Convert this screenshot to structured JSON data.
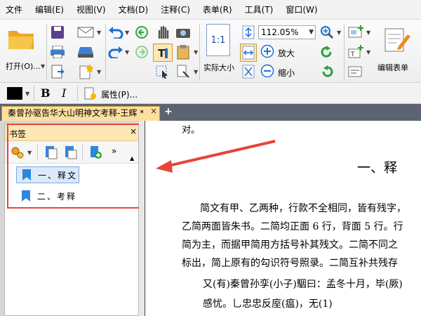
{
  "menu": [
    "文件",
    "编辑(E)",
    "视图(V)",
    "文档(D)",
    "注释(C)",
    "表单(R)",
    "工具(T)",
    "窗口(W)"
  ],
  "toolbar": {
    "open_label": "打开(O)...",
    "actual_size_label": "实际大小",
    "actual_size_glyph": "1:1",
    "zoom_value": "112.05%",
    "zoom_in_label": "放大",
    "zoom_out_label": "缩小",
    "edit_form_label": "编辑表单"
  },
  "format": {
    "bold_label": "B",
    "italic_label": "I",
    "properties_label": "属性(P)...",
    "color": "#000000"
  },
  "tab": {
    "title": "秦曾孙驱告华大山明神文考释-王辉 *",
    "close_glyph": "×",
    "add_glyph": "+"
  },
  "bookmarks": {
    "title": "书签",
    "close_glyph": "×",
    "items": [
      "一、释文",
      "二、考释"
    ]
  },
  "document": {
    "top_fragment": "对。",
    "heading": "一、释",
    "lines": [
      "简文有甲、乙两种，行款不全相同，皆有残字，",
      "乙简两面皆朱书。二简均正面 6 行，背面 5 行。行",
      "简为主，而据甲简用方括号补其残文。二简不同之",
      "标出，简上原有的勾识符号照录。二简互补共残存",
      "又(有)秦曾孙孪(小子)駰曰：孟冬十月，毕(厥)",
      "感忧。乚忠忠反庢(瘟)，无(1)"
    ]
  },
  "colors": {
    "accent_tab": "#fde0a0",
    "annotation_red": "#e8443a",
    "bookmark_blue": "#2e86de"
  }
}
